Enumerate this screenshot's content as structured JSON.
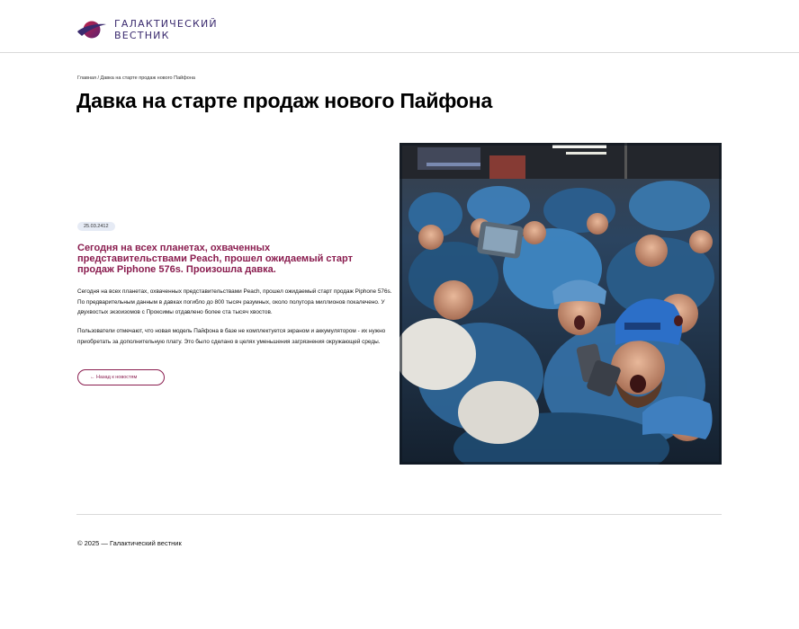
{
  "header": {
    "logo_line1": "ГАЛАКТИЧЕСКИЙ",
    "logo_line2": "ВЕСТНИК",
    "logo_icon": "planet-swoosh-icon"
  },
  "breadcrumb": "Главная / Давка на старте продаж нового Пайфона",
  "article": {
    "title": "Давка на старте продаж нового Пайфона",
    "date": "25.03.2412",
    "lead": "Сегодня на всех планетах, охваченных представительствами Peach, прошел ожидаемый старт продаж Piphone 576s. Произошла давка.",
    "paragraph1": "Сегодня на всех планетах, охваченных представительствами Peach, прошел ожидаемый старт продаж Piphone 576s. По предварительным данным в давках погибло до 800 тысяч разумных, около полутора миллионов покалечено. У двухвостых экзоизомов с Проксимы отдавлено более ста тысяч хвостов.",
    "paragraph2": "Пользователи отмечают, что новая модель Пайфона в базе не комплектуется экраном и аккумулятором - их нужно приобретать за дополнительную плату. Это было сделано в целях уменьшения загрязнения окружающей среды.",
    "back_label": "← Назад к новостям"
  },
  "footer": {
    "copyright": "© 2025 — Галактический вестник"
  },
  "colors": {
    "accent": "#8a1d4f",
    "brand": "#3a2a6e",
    "badge_bg": "#e6ebf5",
    "rule": "#d9d9d9"
  }
}
